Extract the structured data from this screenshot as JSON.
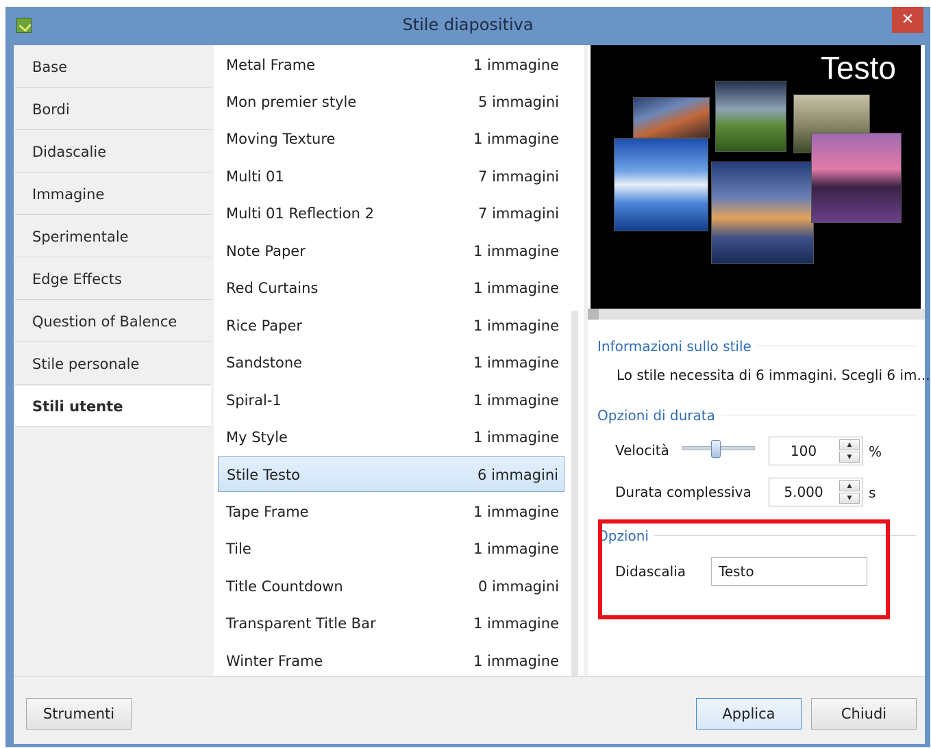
{
  "window": {
    "title": "Stile diapositiva",
    "close_label": "✕"
  },
  "tabs": [
    {
      "label": "Base"
    },
    {
      "label": "Bordi"
    },
    {
      "label": "Didascalie"
    },
    {
      "label": "Immagine"
    },
    {
      "label": "Sperimentale"
    },
    {
      "label": "Edge Effects"
    },
    {
      "label": "Question of Balence"
    },
    {
      "label": "Stile personale"
    },
    {
      "label": "Stili utente",
      "active": true
    }
  ],
  "styles": [
    {
      "name": "Metal Frame",
      "count": "1 immagine"
    },
    {
      "name": "Mon premier style",
      "count": "5 immagini"
    },
    {
      "name": "Moving Texture",
      "count": "1 immagine"
    },
    {
      "name": "Multi 01",
      "count": "7 immagini"
    },
    {
      "name": "Multi 01 Reflection 2",
      "count": "7 immagini"
    },
    {
      "name": "Note Paper",
      "count": "1 immagine"
    },
    {
      "name": "Red Curtains",
      "count": "1 immagine"
    },
    {
      "name": "Rice Paper",
      "count": "1 immagine"
    },
    {
      "name": "Sandstone",
      "count": "1 immagine"
    },
    {
      "name": "Spiral-1",
      "count": "1 immagine"
    },
    {
      "name": "My Style",
      "count": "1 immagine"
    },
    {
      "name": "Stile Testo",
      "count": "6 immagini",
      "selected": true
    },
    {
      "name": "Tape Frame",
      "count": "1 immagine"
    },
    {
      "name": "Tile",
      "count": "1 immagine"
    },
    {
      "name": "Title Countdown",
      "count": "0 immagini"
    },
    {
      "name": "Transparent Title Bar",
      "count": "1 immagine"
    },
    {
      "name": "Winter Frame",
      "count": "1 immagine"
    }
  ],
  "preview": {
    "caption": "Testo"
  },
  "info": {
    "section_label": "Informazioni sullo stile",
    "text": "Lo stile necessita di 6 immagini. Scegli 6 im..."
  },
  "duration": {
    "section_label": "Opzioni di durata",
    "speed_label": "Velocità",
    "speed_value": "100",
    "speed_unit": "%",
    "total_label": "Durata complessiva",
    "total_value": "5.000",
    "total_unit": "s"
  },
  "options": {
    "section_label": "Opzioni",
    "caption_label": "Didascalia",
    "caption_value": "Testo"
  },
  "buttons": {
    "tools": "Strumenti",
    "apply": "Applica",
    "close": "Chiudi"
  },
  "colors": {
    "titlebar": "#6a93c6",
    "close": "#c9483e",
    "accent": "#2f6db5",
    "highlight_box": "#e8121a"
  }
}
